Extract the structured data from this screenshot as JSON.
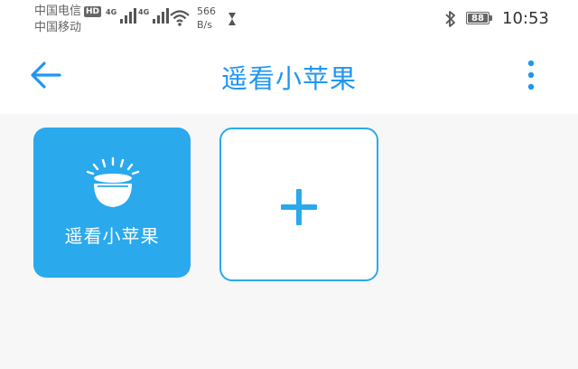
{
  "status_bar": {
    "carrier_1": "中国电信",
    "carrier_1_badge": "HD",
    "carrier_2": "中国移动",
    "signal_1_label": "4G",
    "signal_2_label": "4G",
    "net_speed_value": "566",
    "net_speed_unit": "B/s",
    "battery_level": "88",
    "time": "10:53",
    "icons": [
      "signal-icon",
      "wifi-icon",
      "hourglass-icon",
      "bluetooth-icon",
      "battery-icon"
    ]
  },
  "app_bar": {
    "title": "遥看小苹果",
    "back_icon": "arrow-left-icon",
    "menu_icon": "more-vertical-icon"
  },
  "devices": [
    {
      "label": "遥看小苹果",
      "icon": "lamp-icon"
    }
  ],
  "add_tile": {
    "icon": "plus-icon"
  },
  "colors": {
    "accent": "#2196f3",
    "tile_blue": "#2aa9ec",
    "background": "#f7f7f7"
  }
}
